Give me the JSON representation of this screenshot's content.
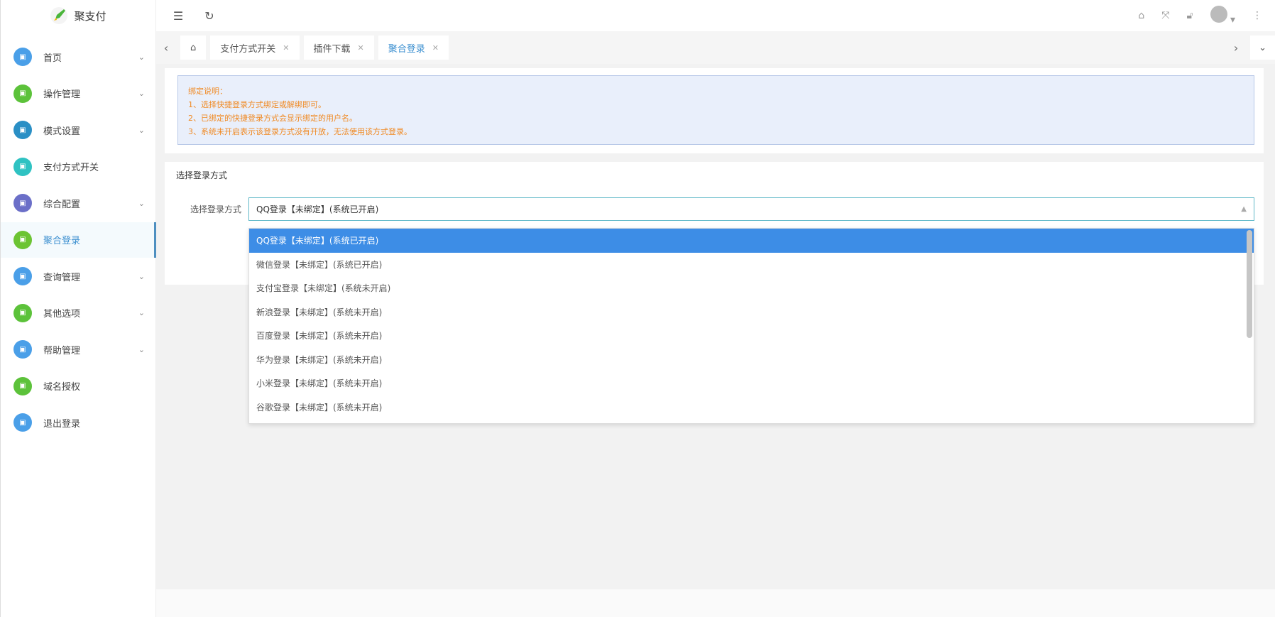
{
  "app": {
    "name": "聚支付"
  },
  "sidebar": {
    "items": [
      {
        "label": "首页",
        "color": "#4a9fe8",
        "chevron": true
      },
      {
        "label": "操作管理",
        "color": "#5cc23a",
        "chevron": true
      },
      {
        "label": "模式设置",
        "color": "#2a8fc5",
        "chevron": true
      },
      {
        "label": "支付方式开关",
        "color": "#2fc2c2",
        "chevron": false
      },
      {
        "label": "综合配置",
        "color": "#6b6fc8",
        "chevron": true
      },
      {
        "label": "聚合登录",
        "color": "#6cc433",
        "chevron": false,
        "active": true
      },
      {
        "label": "查询管理",
        "color": "#4a9fe8",
        "chevron": true
      },
      {
        "label": "其他选项",
        "color": "#5cc23a",
        "chevron": true
      },
      {
        "label": "帮助管理",
        "color": "#4a9fe8",
        "chevron": true
      },
      {
        "label": "域名授权",
        "color": "#5cc23a",
        "chevron": false
      },
      {
        "label": "退出登录",
        "color": "#4a9fe8",
        "chevron": false
      }
    ]
  },
  "tabs": [
    {
      "label": "支付方式开关"
    },
    {
      "label": "插件下载"
    },
    {
      "label": "聚合登录",
      "active": true
    }
  ],
  "notice": {
    "title": "绑定说明：",
    "lines": [
      "1、选择快捷登录方式绑定或解绑即可。",
      "2、已绑定的快捷登录方式会显示绑定的用户名。",
      "3、系统未开启表示该登录方式没有开放，无法使用该方式登录。"
    ]
  },
  "form": {
    "section_title": "选择登录方式",
    "label": "选择登录方式",
    "selected": "QQ登录【未绑定】(系统已开启)",
    "options": [
      "QQ登录【未绑定】(系统已开启)",
      "微信登录【未绑定】(系统已开启)",
      "支付宝登录【未绑定】(系统未开启)",
      "新浪登录【未绑定】(系统未开启)",
      "百度登录【未绑定】(系统未开启)",
      "华为登录【未绑定】(系统未开启)",
      "小米登录【未绑定】(系统未开启)",
      "谷歌登录【未绑定】(系统未开启)"
    ]
  }
}
